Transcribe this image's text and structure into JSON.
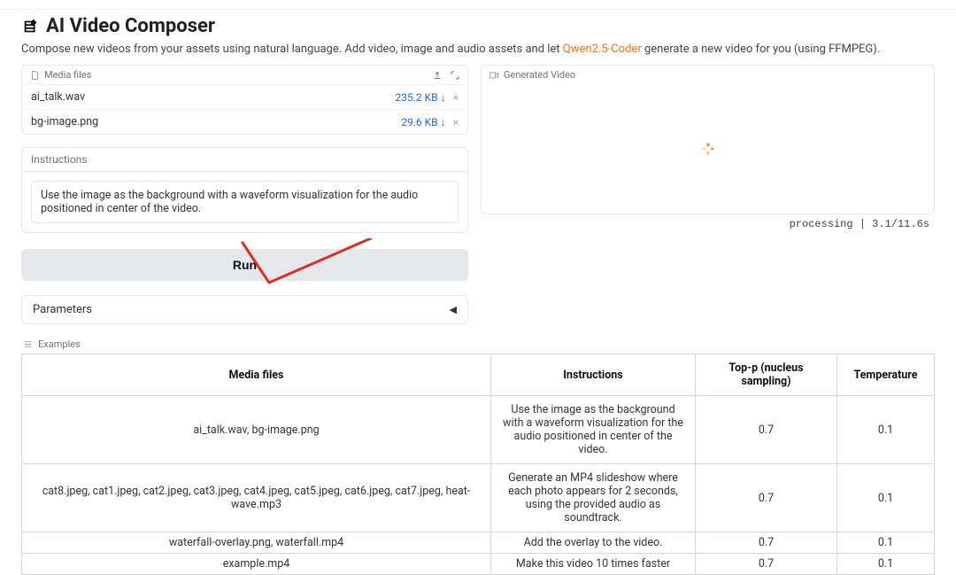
{
  "header": {
    "title": "AI Video Composer",
    "subtitle_prefix": "Compose new videos from your assets using natural language. Add video, image and audio assets and let ",
    "subtitle_link": "Qwen2.5-Coder",
    "subtitle_suffix": " generate a new video for you (using FFMPEG)."
  },
  "media": {
    "label": "Media files",
    "files": [
      {
        "name": "ai_talk.wav",
        "size": "235.2 KB ↓"
      },
      {
        "name": "bg-image.png",
        "size": "29.6 KB ↓"
      }
    ]
  },
  "instructions": {
    "label": "Instructions",
    "value": "Use the image as the background with a waveform visualization for the audio positioned in center of the video."
  },
  "run_label": "Run",
  "parameters_label": "Parameters",
  "generated": {
    "label": "Generated Video",
    "status": "processing | 3.1/11.6s"
  },
  "examples": {
    "label": "Examples",
    "columns": [
      "Media files",
      "Instructions",
      "Top-p (nucleus sampling)",
      "Temperature"
    ],
    "rows": [
      {
        "media": "ai_talk.wav, bg-image.png",
        "instructions": "Use the image as the background with a waveform visualization for the audio positioned in center of the video.",
        "top_p": "0.7",
        "temperature": "0.1",
        "tight": false
      },
      {
        "media": "cat8.jpeg, cat1.jpeg, cat2.jpeg, cat3.jpeg, cat4.jpeg, cat5.jpeg, cat6.jpeg, cat7.jpeg, heat-wave.mp3",
        "instructions": "Generate an MP4 slideshow where each photo appears for 2 seconds, using the provided audio as soundtrack.",
        "top_p": "0.7",
        "temperature": "0.1",
        "tight": false
      },
      {
        "media": "waterfall-overlay.png, waterfall.mp4",
        "instructions": "Add the overlay to the video.",
        "top_p": "0.7",
        "temperature": "0.1",
        "tight": true
      },
      {
        "media": "example.mp4",
        "instructions": "Make this video 10 times faster",
        "top_p": "0.7",
        "temperature": "0.1",
        "tight": true
      }
    ]
  }
}
